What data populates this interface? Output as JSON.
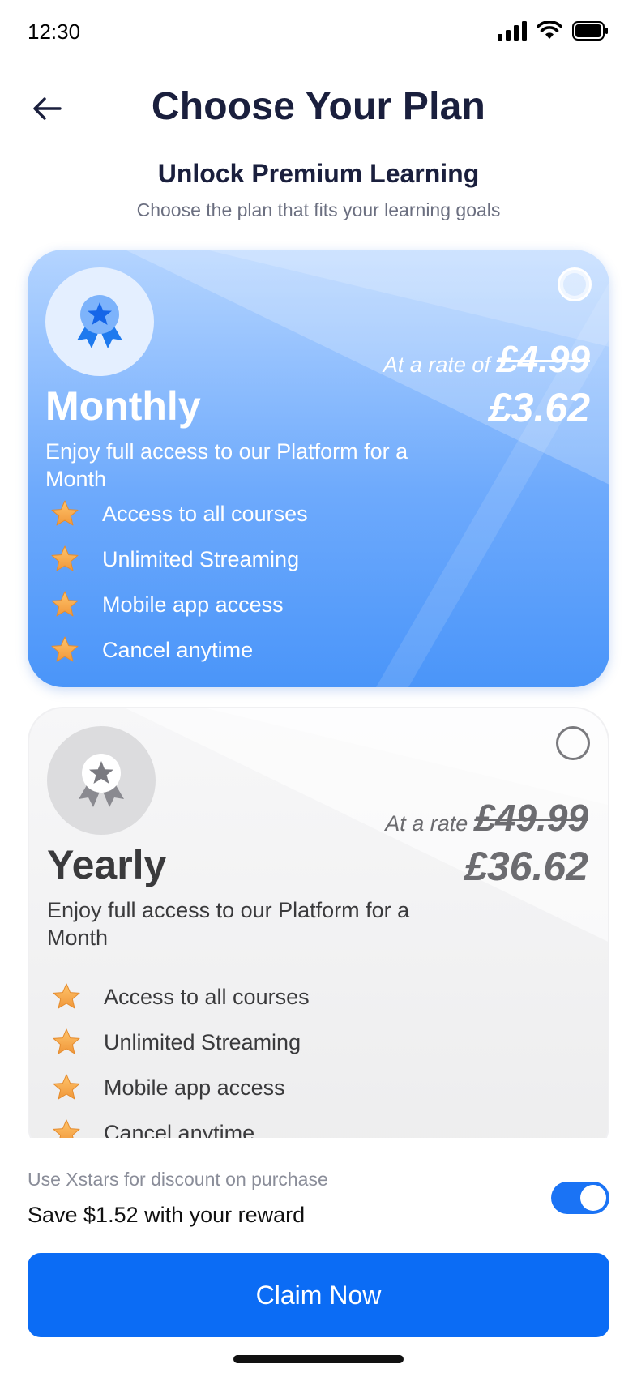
{
  "status_bar": {
    "time": "12:30"
  },
  "header": {
    "title": "Choose Your Plan"
  },
  "intro": {
    "title": "Unlock Premium Learning",
    "subtitle": "Choose the plan that fits your learning goals"
  },
  "plans": [
    {
      "name": "Monthly",
      "rate_label": "At a rate of",
      "old_price": "£4.99",
      "new_price": "£3.62",
      "description": "Enjoy full access to our Platform for a Month",
      "features": [
        "Access to all courses",
        "Unlimited Streaming",
        "Mobile app access",
        "Cancel anytime"
      ],
      "accent": "#4a95f9"
    },
    {
      "name": "Yearly",
      "rate_label": "At a rate",
      "old_price": "£49.99",
      "new_price": "£36.62",
      "description": "Enjoy full access to our Platform for a Month",
      "features": [
        "Access to all courses",
        "Unlimited Streaming",
        "Mobile app access",
        "Cancel anytime"
      ],
      "accent": "#7a7a7e"
    }
  ],
  "reward": {
    "hint": "Use Xstars for discount on purchase",
    "text": "Save $1.52 with your reward",
    "toggle_on": true
  },
  "cta": {
    "label": "Claim Now",
    "color": "#0b6cf5"
  }
}
